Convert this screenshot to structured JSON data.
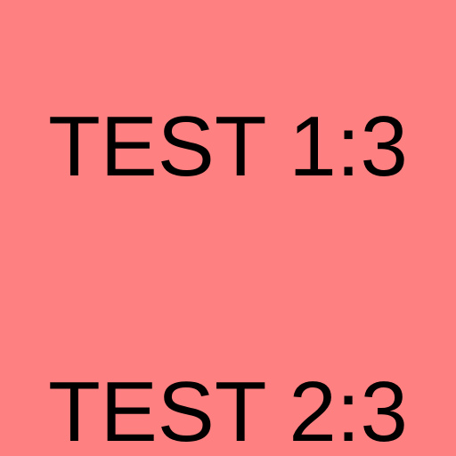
{
  "page": {
    "background_color": "#ff8080",
    "text_color": "#000000",
    "lines": [
      {
        "text": "TEST 1:3"
      },
      {
        "text": "TEST 2:3"
      }
    ]
  }
}
